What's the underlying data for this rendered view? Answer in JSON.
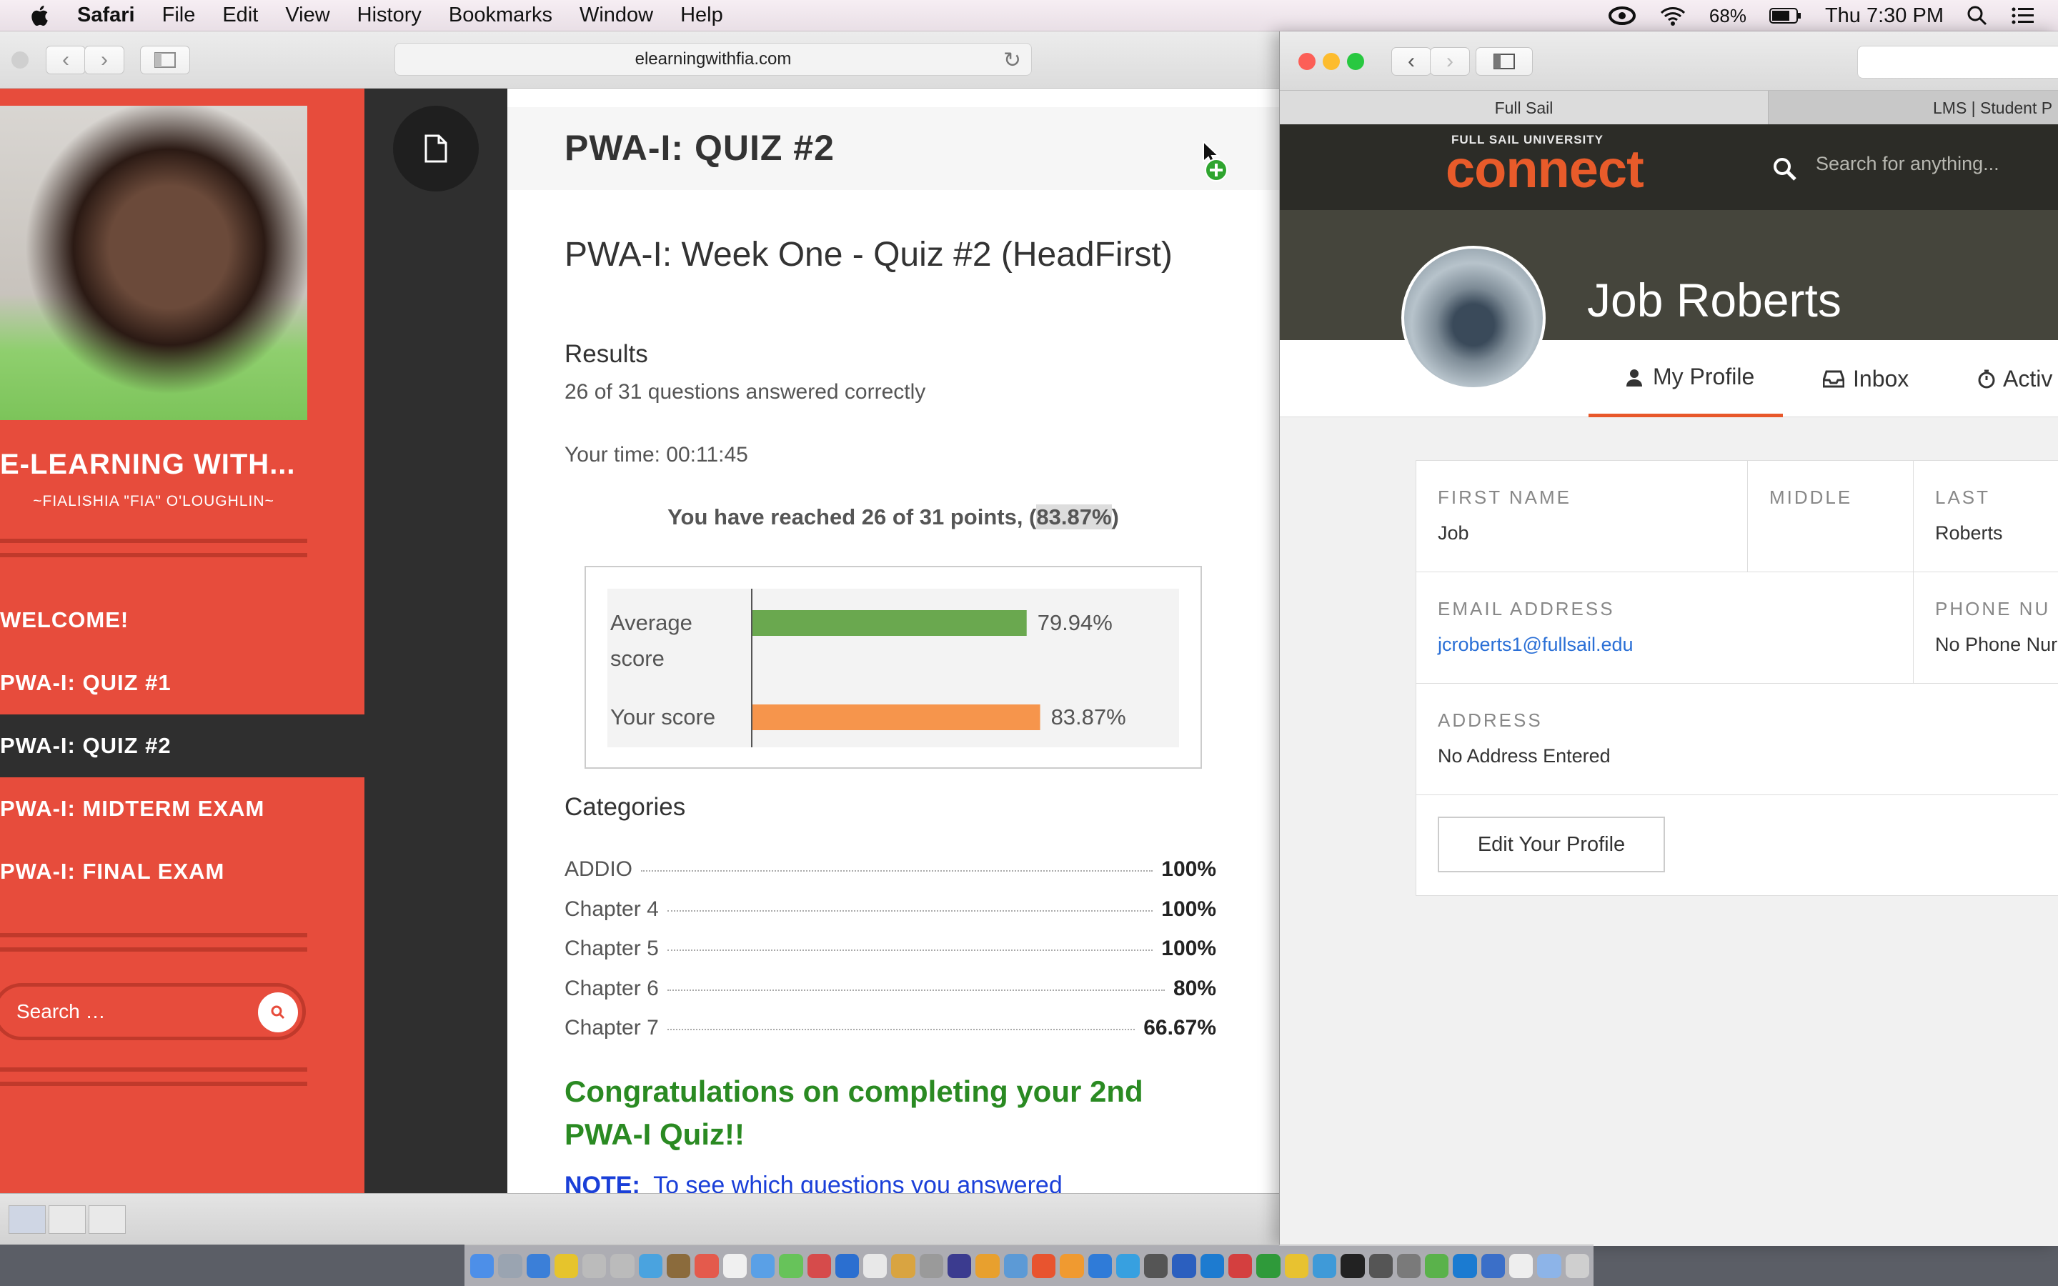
{
  "menubar": {
    "app": "Safari",
    "items": [
      "File",
      "Edit",
      "View",
      "History",
      "Bookmarks",
      "Window",
      "Help"
    ],
    "battery": "68%",
    "clock": "Thu 7:30 PM"
  },
  "safari": {
    "url": "elearningwithfia.com"
  },
  "site": {
    "title": "E-LEARNING WITH...",
    "tagline": "~FIALISHIA \"FIA\" O'LOUGHLIN~",
    "nav": [
      "WELCOME!",
      "PWA-I: QUIZ #1",
      "PWA-I: QUIZ #2",
      "PWA-I: MIDTERM EXAM",
      "PWA-I: FINAL EXAM"
    ],
    "search_placeholder": "Search …"
  },
  "quiz": {
    "page_title": "PWA-I: QUIZ #2",
    "title": "PWA-I: Week One - Quiz #2 (HeadFirst)",
    "results_label": "Results",
    "answered": "26 of 31 questions answered correctly",
    "time": "Your time: 00:11:45",
    "points_prefix": "You have reached 26 of 31 points, (",
    "points_pct": "83.87%",
    "points_suffix": ")",
    "categories_label": "Categories",
    "categories": [
      {
        "name": "ADDIO",
        "value": "100%"
      },
      {
        "name": "Chapter 4",
        "value": "100%"
      },
      {
        "name": "Chapter 5",
        "value": "100%"
      },
      {
        "name": "Chapter 6",
        "value": "80%"
      },
      {
        "name": "Chapter 7",
        "value": "66.67%"
      }
    ],
    "congrats": "Congratulations on completing your 2nd PWA-I Quiz!!",
    "note_label": "NOTE:",
    "note_text": "To see which questions you answered"
  },
  "chart_data": {
    "type": "bar",
    "orientation": "horizontal",
    "categories": [
      "Average score",
      "Your score"
    ],
    "values": [
      79.94,
      83.87
    ],
    "value_labels": [
      "79.94%",
      "83.87%"
    ],
    "colors": [
      "#6aa84f",
      "#f6954c"
    ],
    "xlim": [
      0,
      100
    ]
  },
  "fullsail": {
    "tabs": [
      "Full Sail",
      "LMS | Student P"
    ],
    "logo_small": "FULL SAIL UNIVERSITY",
    "logo_big": "connect",
    "search_placeholder": "Search for anything...",
    "name": "Job Roberts",
    "nav": [
      "My Profile",
      "Inbox",
      "Activ"
    ],
    "fields": {
      "first_label": "FIRST NAME",
      "first_value": "Job",
      "middle_label": "MIDDLE",
      "last_label": "LAST",
      "last_value": "Roberts",
      "email_label": "EMAIL ADDRESS",
      "email_value": "jcroberts1@fullsail.edu",
      "phone_label": "PHONE NU",
      "phone_value": "No Phone Nur",
      "address_label": "ADDRESS",
      "address_value": "No Address Entered"
    },
    "edit_button": "Edit Your Profile"
  },
  "colors": {
    "site_red": "#e74c3c",
    "dark": "#2f2f2f",
    "congrats_green": "#2a8a22",
    "accent_orange": "#e8582a"
  }
}
